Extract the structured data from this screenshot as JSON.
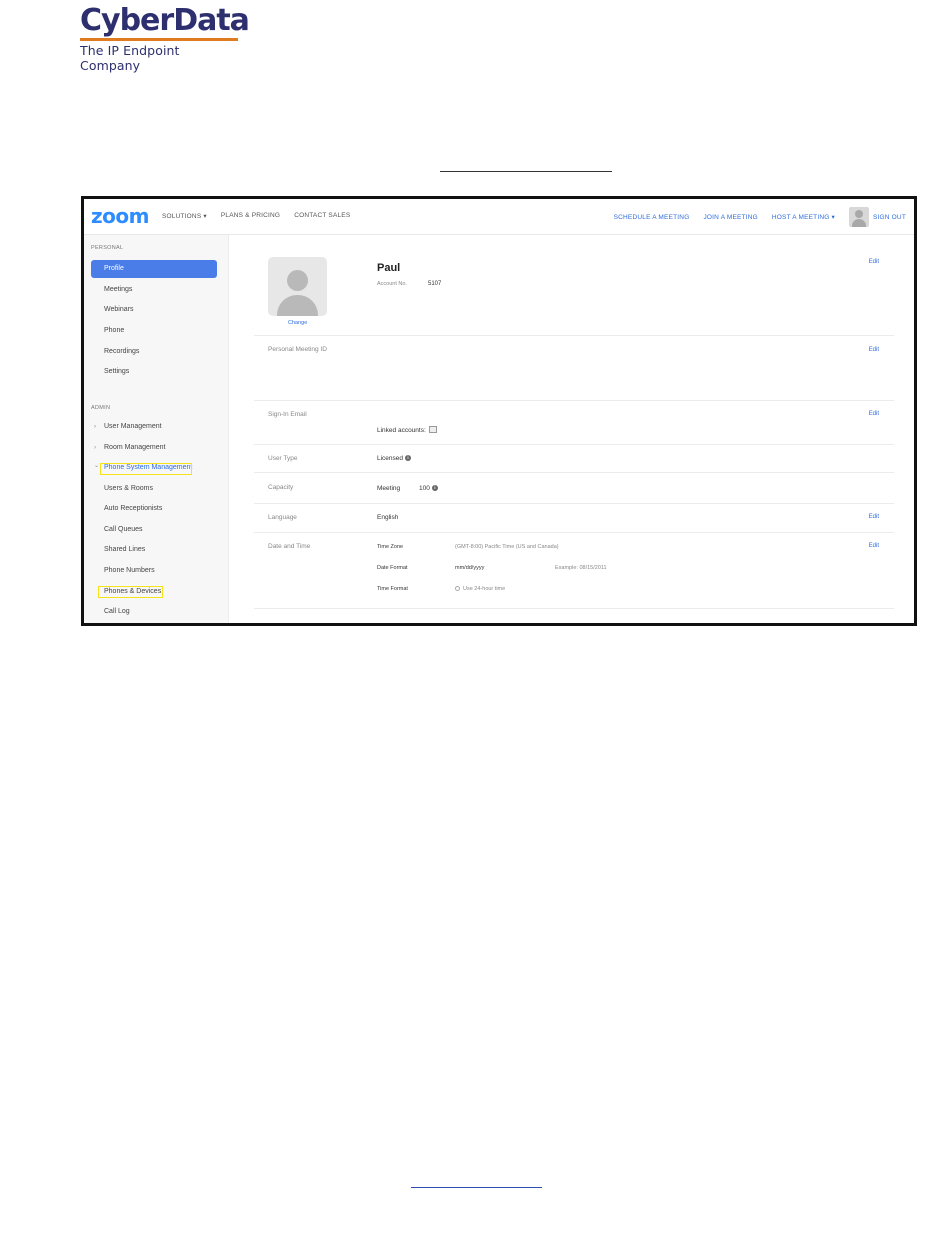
{
  "document": {
    "logo_main": "CyberData",
    "logo_tagline": "The IP Endpoint Company"
  },
  "topnav": {
    "logo": "zoom",
    "left_items": [
      "SOLUTIONS ▾",
      "PLANS & PRICING",
      "CONTACT SALES"
    ],
    "schedule": "SCHEDULE A MEETING",
    "join": "JOIN A MEETING",
    "host": "HOST A MEETING ▾",
    "signout": "SIGN OUT"
  },
  "sidebar": {
    "personal_header": "PERSONAL",
    "personal_items": [
      "Profile",
      "Meetings",
      "Webinars",
      "Phone",
      "Recordings",
      "Settings"
    ],
    "admin_header": "ADMIN",
    "admin_items": [
      "User Management",
      "Room Management",
      "Phone System Management"
    ],
    "phone_sub_items": [
      "Users & Rooms",
      "Auto Receptionists",
      "Call Queues",
      "Shared Lines",
      "Phone Numbers",
      "Phones & Devices",
      "Call Log"
    ],
    "chevron_collapsed": "›",
    "chevron_expanded": "⌄"
  },
  "profile": {
    "change": "Change",
    "name": "Paul",
    "account_label": "Account No.",
    "account_value": "5107",
    "edit": "Edit",
    "personal_meeting_id": "Personal Meeting ID",
    "sign_in_email": "Sign-In Email",
    "linked_accounts": "Linked accounts:",
    "user_type_label": "User Type",
    "user_type_value": "Licensed",
    "capacity_label": "Capacity",
    "capacity_meeting": "Meeting",
    "capacity_value": "100",
    "language_label": "Language",
    "language_value": "English",
    "datetime_label": "Date and Time",
    "timezone_label": "Time Zone",
    "timezone_value": "(GMT-8:00) Pacific Time (US and Canada)",
    "date_format_label": "Date Format",
    "date_format_value": "mm/dd/yyyy",
    "date_example": "Example: 08/15/2011",
    "time_format_label": "Time Format",
    "time_format_value": "Use 24-hour time",
    "info_glyph": "i"
  }
}
